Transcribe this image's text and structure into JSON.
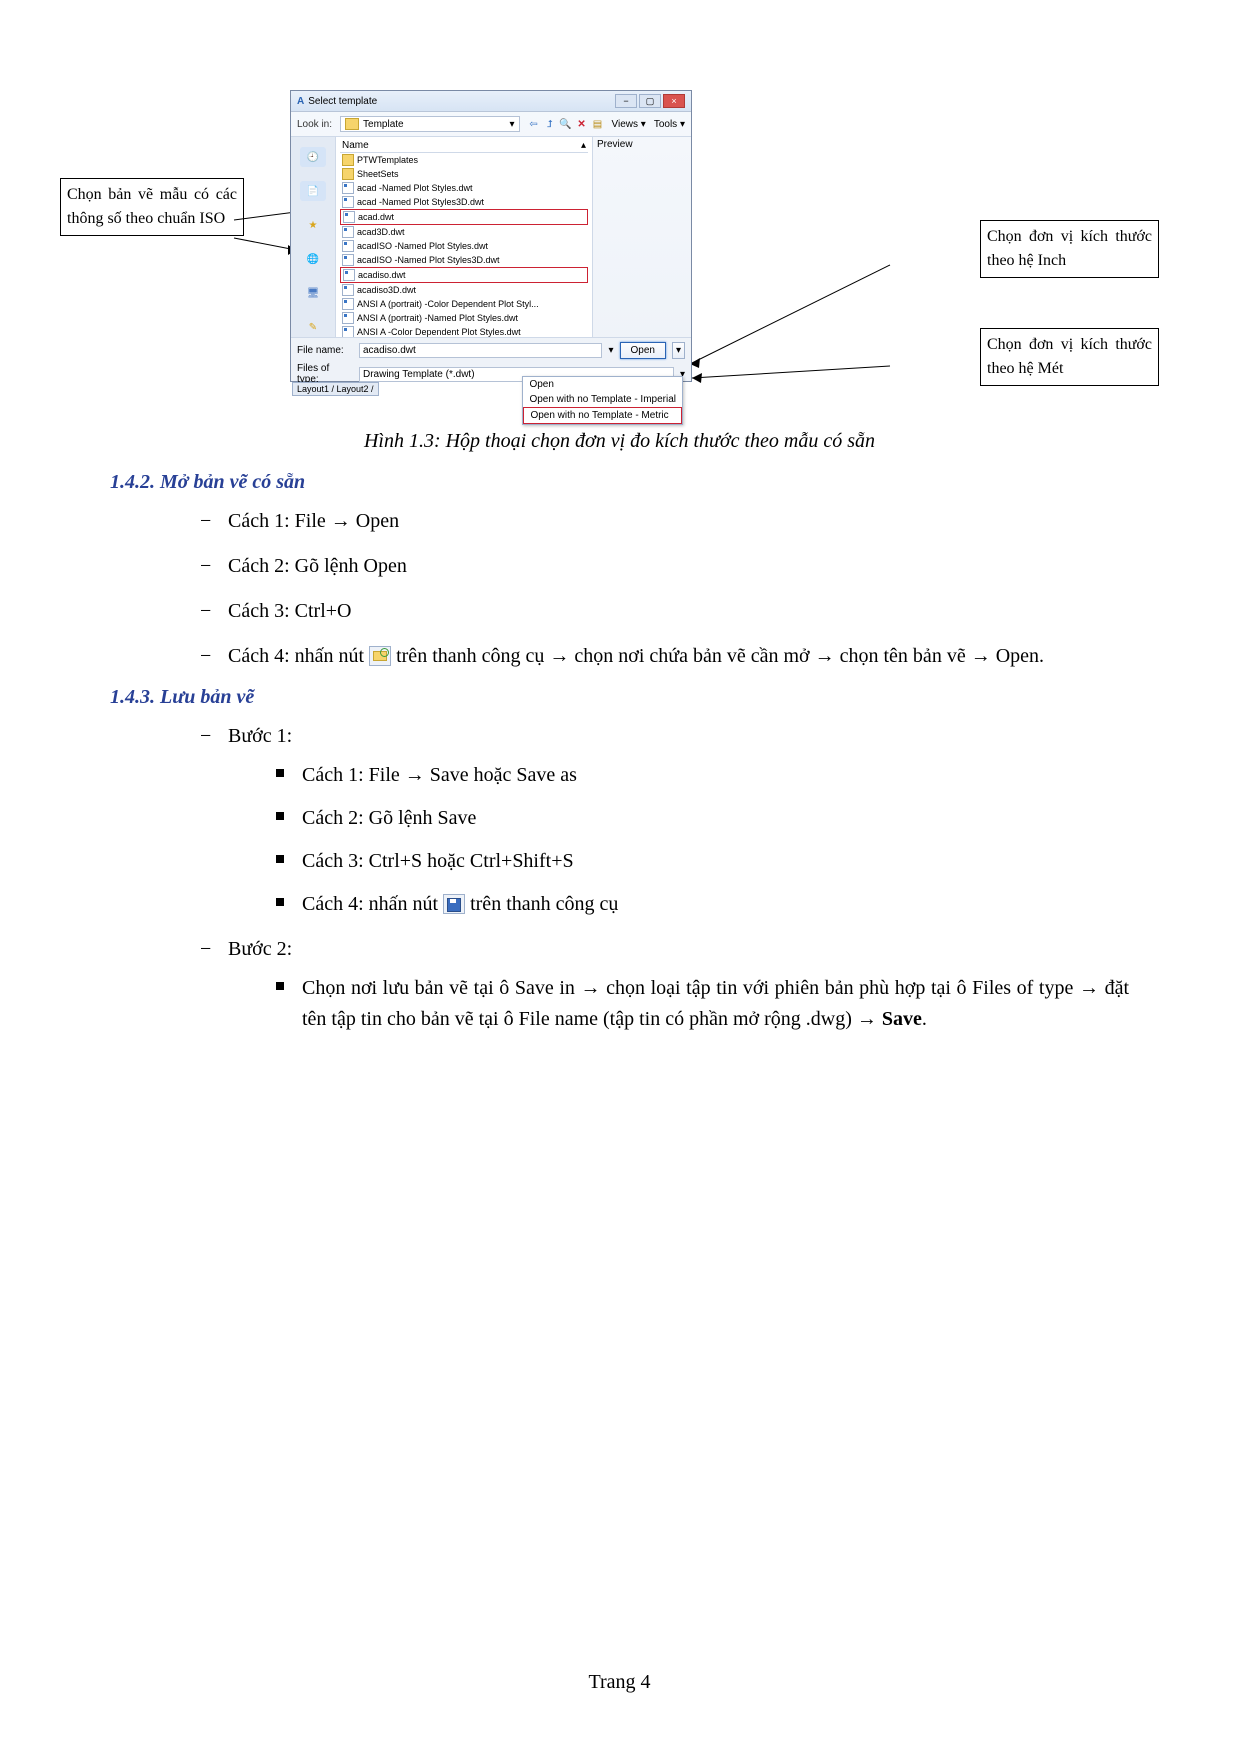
{
  "dialog": {
    "title": "Select template",
    "lookin_label": "Look in:",
    "lookin_value": "Template",
    "views_label": "Views",
    "tools_label": "Tools",
    "col_name": "Name",
    "preview_label": "Preview",
    "files": [
      {
        "name": "PTWTemplates",
        "type": "folder"
      },
      {
        "name": "SheetSets",
        "type": "folder"
      },
      {
        "name": "acad -Named Plot Styles.dwt",
        "type": "file"
      },
      {
        "name": "acad -Named Plot Styles3D.dwt",
        "type": "file"
      },
      {
        "name": "acad.dwt",
        "type": "file",
        "hl": 1
      },
      {
        "name": "acad3D.dwt",
        "type": "file"
      },
      {
        "name": "acadISO -Named Plot Styles.dwt",
        "type": "file"
      },
      {
        "name": "acadISO -Named Plot Styles3D.dwt",
        "type": "file"
      },
      {
        "name": "acadiso.dwt",
        "type": "file",
        "hl": 2
      },
      {
        "name": "acadiso3D.dwt",
        "type": "file"
      },
      {
        "name": "ANSI A (portrait) -Color Dependent Plot Styl...",
        "type": "file"
      },
      {
        "name": "ANSI A (portrait) -Named Plot Styles.dwt",
        "type": "file"
      },
      {
        "name": "ANSI A -Color Dependent Plot Styles.dwt",
        "type": "file"
      }
    ],
    "sidebar_labels": [
      "History",
      "My Documents",
      "Favorites",
      "FTP",
      "Desktop",
      "Buzzsaw"
    ],
    "filename_label": "File name:",
    "filename_value": "acadiso.dwt",
    "filetype_label": "Files of type:",
    "filetype_value": "Drawing Template (*.dwt)",
    "open_btn": "Open",
    "menu": {
      "open": "Open",
      "imperial": "Open with no Template - Imperial",
      "metric": "Open with no Template - Metric"
    }
  },
  "stubtabs": "Layout1 / Layout2 /",
  "callouts": {
    "left": "Chọn bản vẽ mẫu có các thông số theo chuẩn ISO",
    "right1": "Chọn đơn vị kích thước theo hệ Inch",
    "right2": "Chọn đơn vị kích thước theo hệ Mét"
  },
  "caption": "Hình 1.3: Hộp thoại chọn đơn vị đo kích thước theo mẫu có sẵn",
  "sec142": "1.4.2.  Mở bản vẽ có sẵn",
  "open_list": {
    "c1a": "Cách 1: File ",
    "c1b": " Open",
    "c2": "Cách 2: Gõ lệnh Open",
    "c3": "Cách 3: Ctrl+O",
    "c4a": "Cách 4: nhấn nút ",
    "c4b": " trên thanh công cụ ",
    "c4c": " chọn nơi chứa bản vẽ cần mở ",
    "c4d": " chọn tên bản vẽ ",
    "c4e": " Open."
  },
  "sec143": "1.4.3.  Lưu bản vẽ",
  "save": {
    "b1": "Bước 1:",
    "s1a": "Cách 1: File ",
    "s1b": " Save hoặc Save as",
    "s2": "Cách 2: Gõ lệnh Save",
    "s3": "Cách 3: Ctrl+S hoặc Ctrl+Shift+S",
    "s4a": "Cách 4: nhấn nút ",
    "s4b": " trên thanh công cụ",
    "b2": "Bước 2:",
    "p2a": "Chọn nơi lưu bản vẽ tại ô Save in ",
    "p2b": " chọn loại tập tin với phiên bản phù hợp tại ô Files of type ",
    "p2c": " đặt tên tập tin cho bản vẽ tại ô File name (tập tin có phần mở rộng .dwg) ",
    "p2d": " Save",
    "p2e": "."
  },
  "arrow": "→",
  "pagenum": "Trang 4"
}
